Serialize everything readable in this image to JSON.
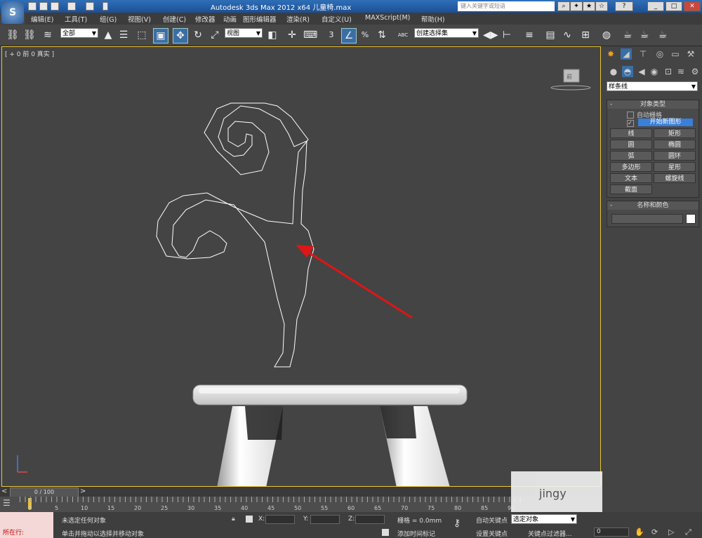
{
  "title_bar": {
    "title": "Autodesk 3ds Max  2012 x64      儿童椅.max",
    "search_placeholder": "键入关键字或短语",
    "help_label": "?"
  },
  "app_logo": "S",
  "menu": [
    "编辑(E)",
    "工具(T)",
    "组(G)",
    "视图(V)",
    "创建(C)",
    "修改器",
    "动画",
    "图形编辑器",
    "渲染(R)",
    "自定义(U)",
    "MAXScript(M)",
    "帮助(H)"
  ],
  "toolbar": {
    "selection_filter": "全部",
    "reference_coord": "视图",
    "snap_label": "3",
    "percent_label": "%",
    "named_selection": "创建选择集",
    "abc_label": "ABC"
  },
  "viewport": {
    "label": "[ + 0 前 0 真实 ]",
    "viewcube": "前"
  },
  "command_panel": {
    "category_dropdown": "样条线",
    "object_type": {
      "header": "对象类型",
      "auto_grid": "自动栅格",
      "start_new_shape": "开始新图形",
      "buttons": [
        "线",
        "矩形",
        "圆",
        "椭圆",
        "弧",
        "圆环",
        "多边形",
        "星形",
        "文本",
        "螺旋线",
        "截面"
      ]
    },
    "name_color": {
      "header": "名称和颜色"
    },
    "collapse": "-"
  },
  "timeline": {
    "frame": "0 / 100",
    "ticks": [
      "0",
      "5",
      "10",
      "15",
      "20",
      "25",
      "30",
      "35",
      "40",
      "45",
      "50",
      "55",
      "60",
      "65",
      "70",
      "75",
      "80",
      "85",
      "90"
    ]
  },
  "status": {
    "selection": "未选定任何对象",
    "prompt": "单击并拖动以选择并移动对象",
    "x_label": "X:",
    "y_label": "Y:",
    "z_label": "Z:",
    "grid": "栅格 = 0.0mm",
    "add_time_tag": "添加时间标记",
    "auto_key": "自动关键点",
    "set_key": "设置关键点",
    "selected_object": "选定对象",
    "key_filters": "关键点过滤器...",
    "frame_field": "0",
    "script_listener": "所在行:",
    "watermark": "jingy"
  }
}
